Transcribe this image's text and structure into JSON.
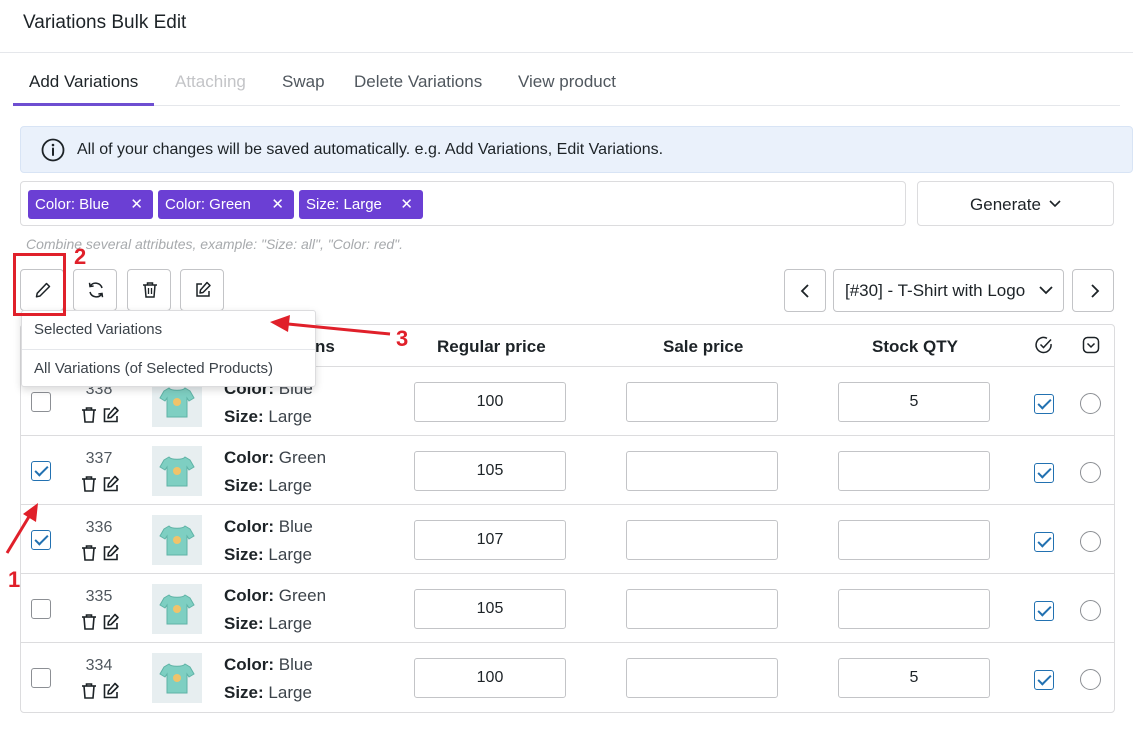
{
  "page": {
    "title": "Variations Bulk Edit"
  },
  "tabs": [
    {
      "label": "Add Variations",
      "state": "active"
    },
    {
      "label": "Attaching",
      "state": "disabled"
    },
    {
      "label": "Swap",
      "state": "normal"
    },
    {
      "label": "Delete Variations",
      "state": "normal"
    },
    {
      "label": "View product",
      "state": "normal"
    }
  ],
  "notice": {
    "text": "All of your changes will be saved automatically. e.g. Add Variations, Edit Variations.",
    "icon": "info-icon"
  },
  "attributes": {
    "chips": [
      {
        "label": "Color: Blue",
        "remove": "✕"
      },
      {
        "label": "Color: Green",
        "remove": "✕"
      },
      {
        "label": "Size: Large",
        "remove": "✕"
      }
    ],
    "hint": "Combine several attributes, example: \"Size: all\", \"Color: red\"."
  },
  "generate": {
    "label": "Generate"
  },
  "toolbar": {
    "icons": [
      "pencil-icon",
      "refresh-icon",
      "trash-icon",
      "edit-icon"
    ]
  },
  "product_select": {
    "value": "[#30] - T-Shirt with Logo"
  },
  "dropdown": {
    "items": [
      "Selected Variations",
      "All Variations (of Selected Products)"
    ]
  },
  "table": {
    "headers": {
      "attributes_partial": "ns",
      "regular_price": "Regular price",
      "sale_price": "Sale price",
      "stock_qty": "Stock QTY"
    },
    "rows": [
      {
        "id": "338",
        "checked": false,
        "color_label": "Color:",
        "color": "Blue",
        "size_label": "Size:",
        "size": "Large",
        "regular_price": "100",
        "sale_price": "",
        "stock": "5"
      },
      {
        "id": "337",
        "checked": true,
        "color_label": "Color:",
        "color": "Green",
        "size_label": "Size:",
        "size": "Large",
        "regular_price": "105",
        "sale_price": "",
        "stock": ""
      },
      {
        "id": "336",
        "checked": true,
        "color_label": "Color:",
        "color": "Blue",
        "size_label": "Size:",
        "size": "Large",
        "regular_price": "107",
        "sale_price": "",
        "stock": ""
      },
      {
        "id": "335",
        "checked": false,
        "color_label": "Color:",
        "color": "Green",
        "size_label": "Size:",
        "size": "Large",
        "regular_price": "105",
        "sale_price": "",
        "stock": ""
      },
      {
        "id": "334",
        "checked": false,
        "color_label": "Color:",
        "color": "Blue",
        "size_label": "Size:",
        "size": "Large",
        "regular_price": "100",
        "sale_price": "",
        "stock": "5"
      }
    ]
  },
  "annotations": {
    "labels": [
      "1",
      "2",
      "3"
    ],
    "color": "#e0202a"
  },
  "colors": {
    "accent": "#6b3fd4",
    "tab_underline": "#6e4ed1",
    "checkbox": "#2271b1",
    "notice_bg": "#eaf1fb"
  }
}
